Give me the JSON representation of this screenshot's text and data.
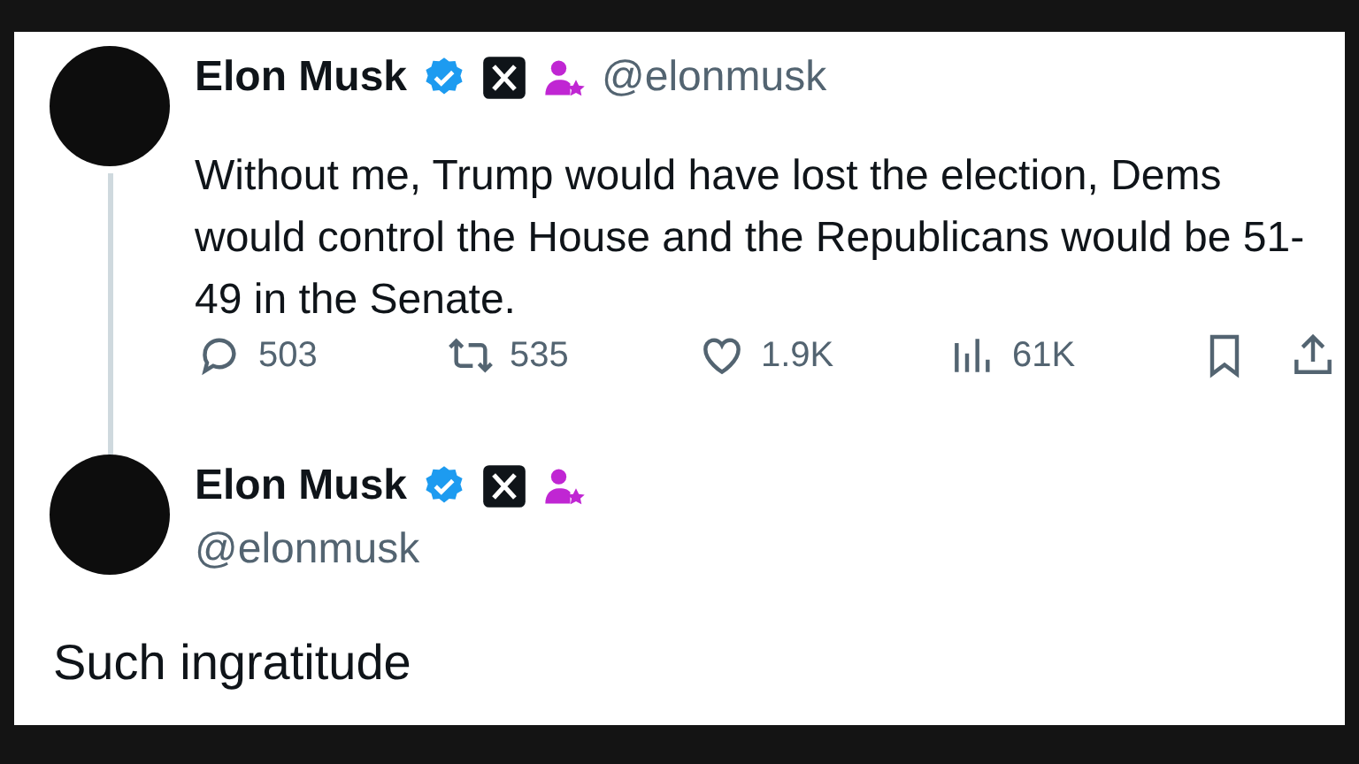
{
  "posts": [
    {
      "kind": "thread",
      "name": "Elon Musk",
      "verified": true,
      "handle": "@elonmusk",
      "text": "Without me, Trump would have lost the election, Dems would control the House and the Republicans would be 51-49 in the Senate.",
      "stats": [
        {
          "kind": "reply",
          "count": "503"
        },
        {
          "kind": "repost",
          "count": "535"
        },
        {
          "kind": "like",
          "count": "1.9K"
        },
        {
          "kind": "views",
          "count": "61K"
        }
      ]
    },
    {
      "kind": "focused",
      "name": "Elon Musk",
      "verified": true,
      "handle": "@elonmusk",
      "text": "Such ingratitude"
    }
  ]
}
